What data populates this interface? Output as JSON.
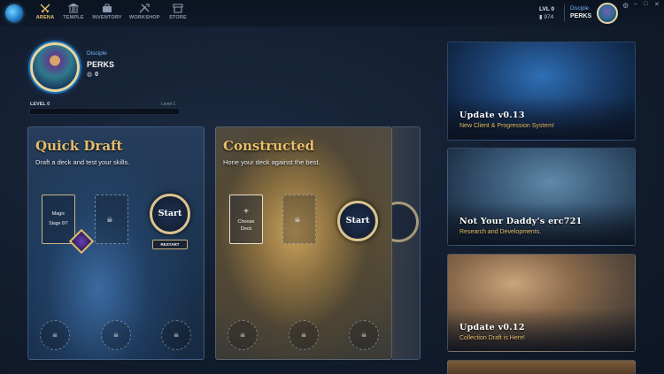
{
  "nav": {
    "items": [
      {
        "label": "ARENA",
        "icon": "swords-icon",
        "active": true
      },
      {
        "label": "TEMPLE",
        "icon": "temple-icon",
        "active": false
      },
      {
        "label": "INVENTORY",
        "icon": "inventory-icon",
        "active": false
      },
      {
        "label": "WORKSHOP",
        "icon": "tools-icon",
        "active": false
      },
      {
        "label": "STORE",
        "icon": "store-icon",
        "active": false
      }
    ]
  },
  "account": {
    "level": "LVL 0",
    "coins": "974",
    "rank": "Disciple",
    "name": "PERKS"
  },
  "profile": {
    "rank": "Disciple",
    "name": "PERKS",
    "gold": "0",
    "level_label": "LEVEL 0",
    "next_level_label": "Level 1",
    "xp_progress": 0
  },
  "modes": {
    "quick_draft": {
      "title": "Quick Draft",
      "subtitle": "Draft a deck and test your skills.",
      "slot_type": "Magic",
      "slot_stage": "Stage 0/7",
      "start": "Start",
      "restart": "RESTART"
    },
    "constructed": {
      "title": "Constructed",
      "subtitle": "Hone your deck against the best.",
      "choose_plus": "+",
      "choose_line1": "Choose",
      "choose_line2": "Deck",
      "start": "Start"
    }
  },
  "news": [
    {
      "title": "Update v0.13",
      "subtitle": "New Client & Progression System!"
    },
    {
      "title": "Not Your Daddy's erc721",
      "subtitle": "Research and Developments."
    },
    {
      "title": "Update v0.12",
      "subtitle": "Collection Draft is Here!"
    }
  ],
  "colors": {
    "accent_gold": "#e7be6a",
    "rank_blue": "#6fb6ff",
    "background": "#121d2e"
  }
}
